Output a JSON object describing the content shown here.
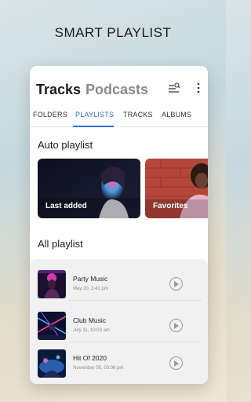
{
  "headline": "SMART PLAYLIST",
  "header": {
    "title_primary": "Tracks",
    "title_secondary": "Podcasts",
    "sort_icon": "sort-search-icon",
    "menu_icon": "more-vert-icon"
  },
  "tabs": [
    {
      "label": "FOLDERS",
      "active": false
    },
    {
      "label": "PLAYLISTS",
      "active": true
    },
    {
      "label": "TRACKS",
      "active": false
    },
    {
      "label": "ALBUMS",
      "active": false
    }
  ],
  "auto_playlist": {
    "title": "Auto playlist",
    "cards": [
      {
        "label": "Last added"
      },
      {
        "label": "Favorites"
      }
    ]
  },
  "all_playlist": {
    "title": "All playlist",
    "items": [
      {
        "name": "Party Music",
        "date": "May 20, 3:41 pm"
      },
      {
        "name": "Club Music",
        "date": "July 11, 10:03 am"
      },
      {
        "name": "Hit Of 2020",
        "date": "November 05, 03:06 pm"
      }
    ]
  },
  "colors": {
    "accent": "#2d6fd6",
    "panel": "#f1f1f1"
  }
}
